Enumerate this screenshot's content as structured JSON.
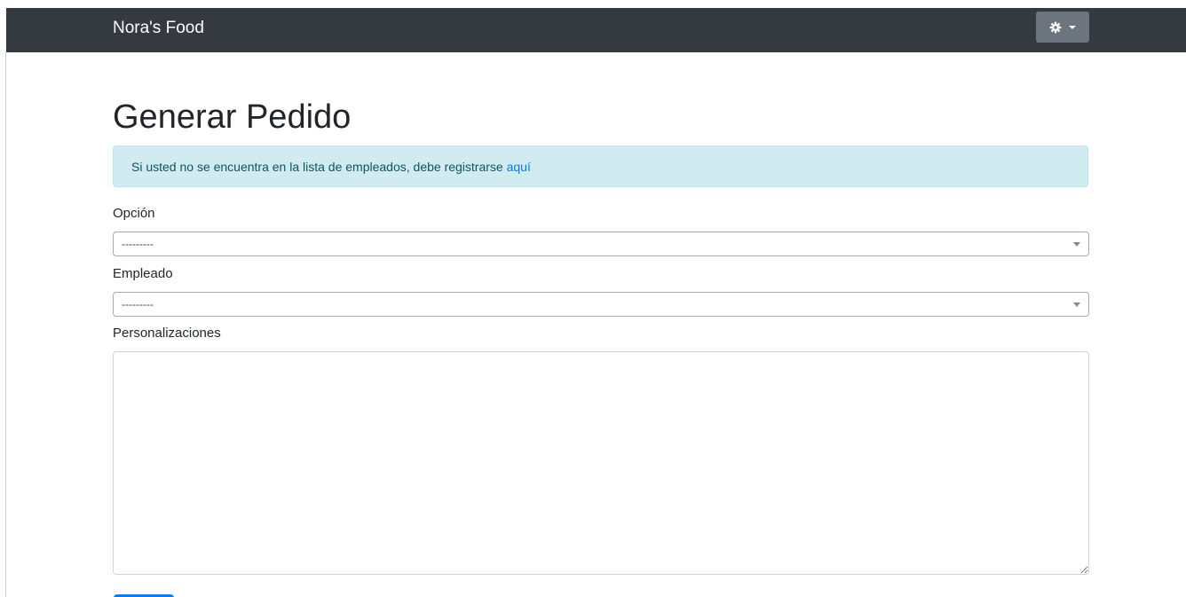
{
  "navbar": {
    "brand": "Nora's Food",
    "settings_icon": "gear-icon",
    "dropdown_icon": "caret-down-icon"
  },
  "page": {
    "title": "Generar Pedido"
  },
  "alert": {
    "message": "Si usted no se encuentra en la lista de empleados, debe registrarse ",
    "link_text": "aquí"
  },
  "form": {
    "opcion": {
      "label": "Opción",
      "selected": "---------"
    },
    "empleado": {
      "label": "Empleado",
      "selected": "---------"
    },
    "personalizaciones": {
      "label": "Personalizaciones",
      "value": ""
    }
  },
  "colors": {
    "navbar_bg": "#343a40",
    "settings_button_bg": "#6c757d",
    "alert_bg": "#d1ecf1",
    "alert_text": "#0c5460",
    "link": "#007bff",
    "primary": "#007bff"
  }
}
